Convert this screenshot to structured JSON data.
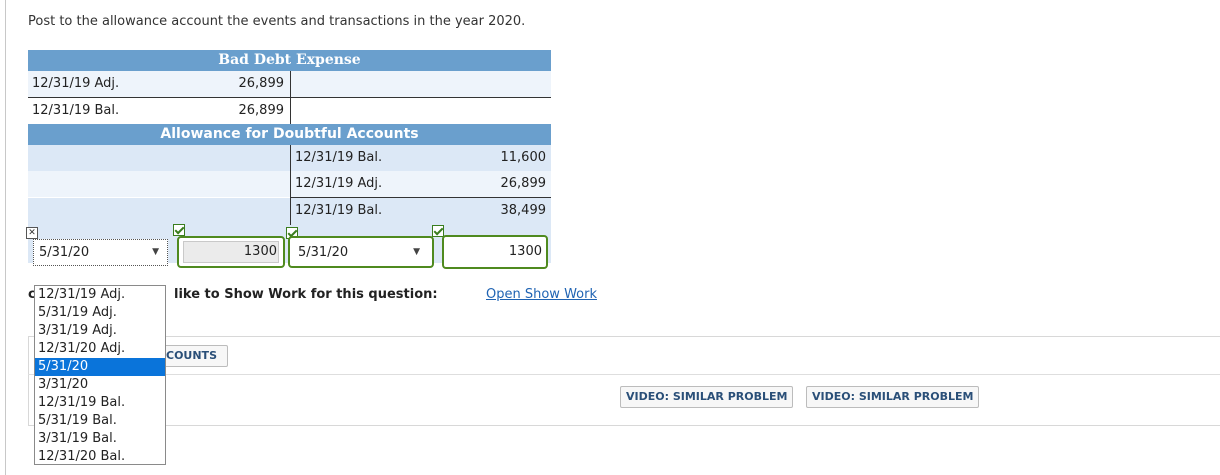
{
  "instruction": "Post to the allowance account the events and transactions in the year 2020.",
  "bad_debt": {
    "title": "Bad Debt Expense",
    "rows": [
      {
        "label": "12/31/19 Adj.",
        "amount": "26,899"
      },
      {
        "label": "12/31/19 Bal.",
        "amount": "26,899"
      }
    ]
  },
  "allowance": {
    "title": "Allowance for Doubtful Accounts",
    "rows": [
      {
        "label": "12/31/19 Bal.",
        "amount": "11,600"
      },
      {
        "label": "12/31/19 Adj.",
        "amount": "26,899"
      },
      {
        "label": "12/31/19 Bal.",
        "amount": "38,499"
      }
    ],
    "entry": {
      "debit_date": "5/31/20",
      "debit_amount": "1300",
      "credit_date": "5/31/20",
      "credit_amount": "1300"
    }
  },
  "dropdown": {
    "options": [
      "12/31/19 Adj.",
      "5/31/19 Adj.",
      "3/31/19 Adj.",
      "12/31/20 Adj.",
      "5/31/20",
      "3/31/20",
      "12/31/19 Bal.",
      "5/31/19 Bal.",
      "3/31/19 Bal.",
      "12/31/20 Bal."
    ],
    "selected": "5/31/20"
  },
  "show_work": {
    "prefix": "c",
    "text": "like to Show Work for this question:",
    "link": "Open Show Work"
  },
  "buttons": {
    "accounts": "COUNTS",
    "video1": "VIDEO: SIMILAR PROBLEM",
    "video2": "VIDEO: SIMILAR PROBLEM"
  },
  "icons": {
    "close": "close-icon",
    "check": "check-icon",
    "arrow": "dropdown-arrow-icon"
  },
  "colors": {
    "header": "#6a9fcd",
    "row_light": "#eef4fb",
    "row_mid": "#dce8f6",
    "correct": "#4f8a1f",
    "selected": "#0a74da",
    "link": "#1f63b3"
  }
}
